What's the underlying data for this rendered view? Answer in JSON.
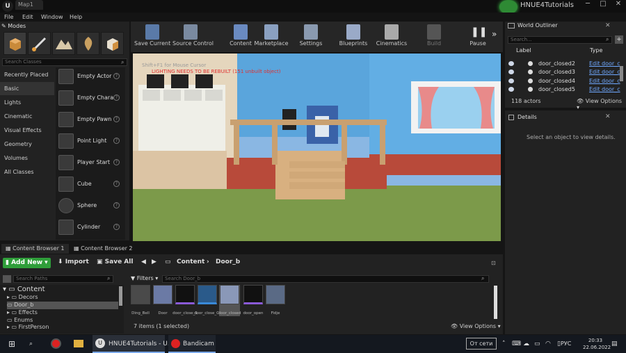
{
  "window": {
    "doc_tab": "Map1",
    "project_name": "HNUE4Tutorials",
    "controls": [
      "─",
      "□",
      "✕"
    ]
  },
  "menu": [
    "File",
    "Edit",
    "Window",
    "Help"
  ],
  "modes": {
    "tab_label": "Modes",
    "search_placeholder": "Search Classes",
    "categories": [
      "Recently Placed",
      "Basic",
      "Lights",
      "Cinematic",
      "Visual Effects",
      "Geometry",
      "Volumes",
      "All Classes"
    ],
    "selected_category": "Basic",
    "items": [
      "Empty Actor",
      "Empty Chara",
      "Empty Pawn",
      "Point Light",
      "Player Start",
      "Cube",
      "Sphere",
      "Cylinder"
    ]
  },
  "toolbar": {
    "buttons": [
      "Save Current",
      "Source Control",
      "Content",
      "Marketplace",
      "Settings",
      "Blueprints",
      "Cinematics",
      "Build",
      "Pause"
    ]
  },
  "viewport": {
    "hint": "Shift+F1 for Mouse Cursor",
    "warning": "LIGHTING NEEDS TO BE REBUILT (151 unbuilt object)"
  },
  "outliner": {
    "title": "World Outliner",
    "search_placeholder": "Search...",
    "col_label": "Label",
    "col_type": "Type",
    "rows": [
      {
        "label": "door_closed2",
        "type": "Edit door_c"
      },
      {
        "label": "door_closed3",
        "type": "Edit door_c"
      },
      {
        "label": "door_closed4",
        "type": "Edit door_c"
      },
      {
        "label": "door_closed5",
        "type": "Edit door_c"
      }
    ],
    "actor_count": "118 actors",
    "view_options": "View Options"
  },
  "details": {
    "title": "Details",
    "empty_message": "Select an object to view details."
  },
  "content_browser": {
    "tabs": [
      "Content Browser 1",
      "Content Browser 2"
    ],
    "add_new": "Add New",
    "import": "Import",
    "save_all": "Save All",
    "path": [
      "Content",
      "Door_b"
    ],
    "search_paths_placeholder": "Search Paths",
    "filters": "Filters",
    "search_placeholder": "Search Door_b",
    "tree": [
      "Content",
      "Decors",
      "Door_b",
      "Effects",
      "Enums",
      "FirstPerson"
    ],
    "selected_folder": "Door_b",
    "assets": [
      "Ding_Bell",
      "Door",
      "door_close_1",
      "door_close_Cue",
      "door_closed",
      "door_open",
      "Fidje"
    ],
    "selected_asset": "door_closed",
    "items_count": "7 items (1 selected)",
    "view_options": "View Options"
  },
  "taskbar": {
    "apps": [
      "HNUE4Tutorials - U...",
      "Bandicam"
    ],
    "network_status": "От сети",
    "language": "РУС",
    "time": "20:33",
    "date": "22.06.2022"
  },
  "colors": {
    "accent_green": "#2f9e3a",
    "link_blue": "#6fa8ff",
    "warning_red": "#e03030"
  }
}
